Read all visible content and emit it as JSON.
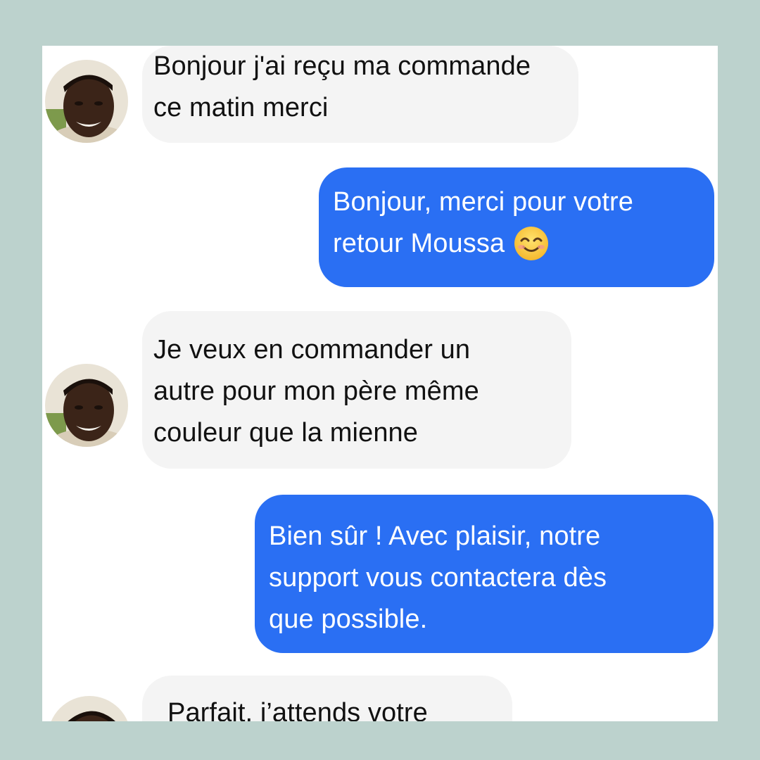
{
  "contact": {
    "name": "Moussa"
  },
  "messages": [
    {
      "direction": "incoming",
      "lines": [
        "Bonjour j'ai reçu ma commande",
        "ce matin merci"
      ]
    },
    {
      "direction": "outgoing",
      "lines": [
        "Bonjour, merci pour votre",
        "retour Moussa"
      ],
      "emoji": "smiling-face-with-smiling-eyes-icon"
    },
    {
      "direction": "incoming",
      "lines": [
        "Je veux en commander un",
        "autre pour mon père même",
        "couleur que la mienne"
      ]
    },
    {
      "direction": "outgoing",
      "lines": [
        "Bien sûr ! Avec plaisir, notre",
        "support vous contactera dès",
        "que possible."
      ]
    },
    {
      "direction": "incoming",
      "lines": [
        "Parfait, j’attends votre"
      ]
    }
  ],
  "colors": {
    "background": "#bcd2cd",
    "incoming_bubble": "#f4f4f4",
    "outgoing_bubble": "#2a6ff3",
    "outgoing_text": "#ffffff",
    "incoming_text": "#111111"
  }
}
